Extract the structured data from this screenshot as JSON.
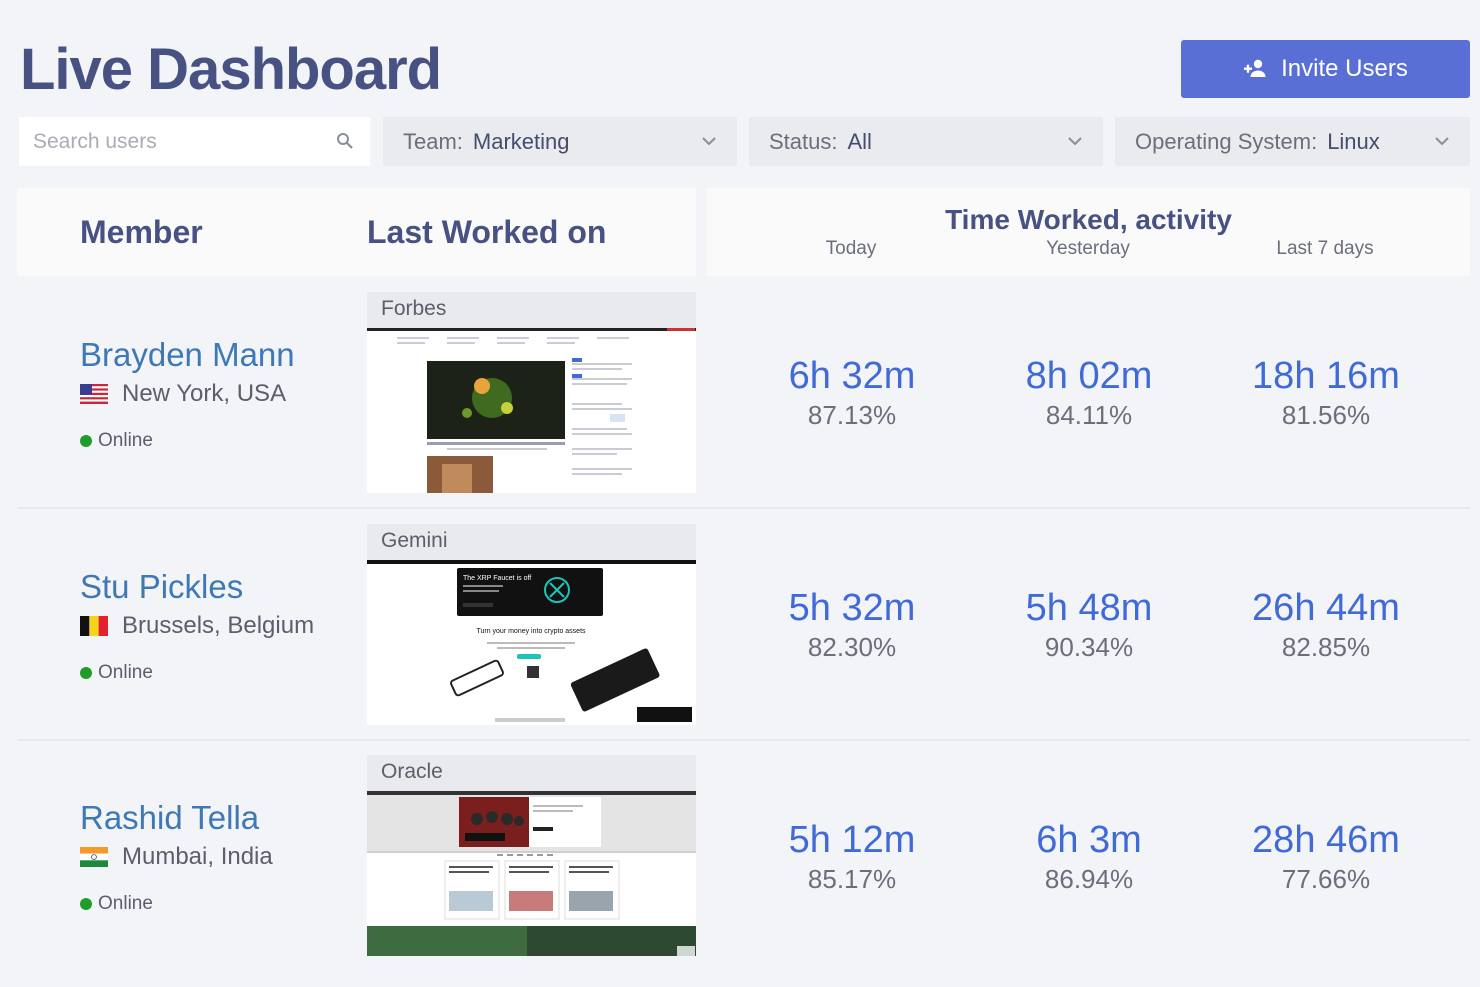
{
  "header": {
    "title": "Live Dashboard",
    "invite_label": "Invite Users"
  },
  "filters": {
    "search_placeholder": "Search users",
    "team_label": "Team:",
    "team_value": "Marketing",
    "status_label": "Status:",
    "status_value": "All",
    "os_label": "Operating System:",
    "os_value": "Linux"
  },
  "columns": {
    "member": "Member",
    "last_worked": "Last Worked on",
    "time_worked": "Time Worked, activity",
    "today": "Today",
    "yesterday": "Yesterday",
    "last7": "Last 7 days"
  },
  "members": [
    {
      "name": "Brayden Mann",
      "location": "New York, USA",
      "flag": "us-flag",
      "status": "Online",
      "site": "Forbes",
      "today_time": "6h 32m",
      "today_pct": "87.13%",
      "yest_time": "8h 02m",
      "yest_pct": "84.11%",
      "week_time": "18h 16m",
      "week_pct": "81.56%"
    },
    {
      "name": "Stu Pickles",
      "location": "Brussels, Belgium",
      "flag": "belgium-flag",
      "status": "Online",
      "site": "Gemini",
      "screenshot_text_1": "The XRP Faucet is off",
      "screenshot_text_2": "Turn your money into crypto assets",
      "today_time": "5h 32m",
      "today_pct": "82.30%",
      "yest_time": "5h 48m",
      "yest_pct": "90.34%",
      "week_time": "26h 44m",
      "week_pct": "82.85%"
    },
    {
      "name": "Rashid Tella",
      "location": "Mumbai, India",
      "flag": "india-flag",
      "status": "Online",
      "site": "Oracle",
      "today_time": "5h 12m",
      "today_pct": "85.17%",
      "yest_time": "6h 3m",
      "yest_pct": "86.94%",
      "week_time": "28h 46m",
      "week_pct": "77.66%"
    }
  ],
  "colors": {
    "accent": "#5a6fd6",
    "title": "#475182",
    "member_name": "#3e78b5",
    "metric": "#3f6ad8",
    "online": "#1f9d2b"
  }
}
